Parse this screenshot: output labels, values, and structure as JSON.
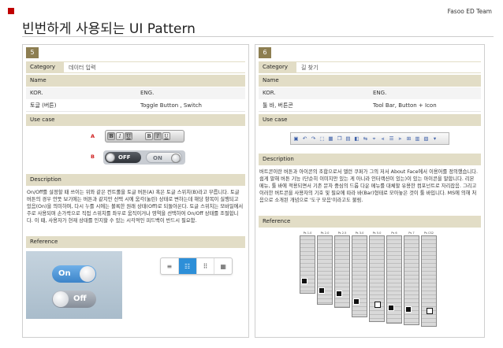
{
  "header": {
    "team": "Fasoo ED Team",
    "title": "빈번하게 사용되는 UI Pattern"
  },
  "colors": {
    "brand": "#c00000",
    "bar": "#e2ddc6",
    "number": "#8d7e51",
    "accent": "#2d8fd8"
  },
  "panels": [
    {
      "number": "5",
      "category_label": "Category",
      "category_value": "데이터 입력",
      "name_label": "Name",
      "kor_label": "KOR.",
      "eng_label": "ENG.",
      "kor_value": "토글 (버튼)",
      "eng_value": "Toggle Button , Switch",
      "usecase_label": "Use case",
      "usecase_a": "A",
      "usecase_b": "B",
      "format_buttons": [
        "B",
        "I",
        "U",
        "B",
        "I",
        "U"
      ],
      "toggle_off": "OFF",
      "toggle_on": "ON",
      "description_label": "Description",
      "description": "On/Off를 설정할 때 쓰이는 위와 같은 컨트롤을 토글 버튼(A) 혹은 토글 스위치(B)라고 부릅니다. 토글 버튼의 경우 언뜻 보기에는 버튼과 같지만 선택 시에 움각(눌린) 상태로 변하는데 해당 항목이 실행되고 있음(On)을 의미하며, 다시 누를 시에는 볼록한 원래 상태(Off)로 되돌아온다. 토글 스위치는 모바일에서 주로 사용되며 손가락으로 직접 스위치를 좌우로 움직이거나 영역을 선택하여 On/Off 상태를 조절합니다. 이 때, 사용자가 현재 상태를 인지할 수 있는 시각적인 피드백이 반드시 필요함.",
      "reference_label": "Reference",
      "ref_on": "On",
      "ref_off": "Off",
      "segment_icons": [
        "≡",
        "☷",
        "⠿",
        "▦"
      ]
    },
    {
      "number": "6",
      "category_label": "Category",
      "category_value": "길 찾기",
      "name_label": "Name",
      "kor_label": "KOR.",
      "eng_label": "ENG.",
      "kor_value": "툴 바, 버튼콘",
      "eng_value": "Tool Bar, Button + Icon",
      "usecase_label": "Use case",
      "description_label": "Description",
      "description": "버트콘이란 버튼과 아이콘의 조합으로서 앨런 쿠퍼가 그의 저서 About Face에서 이용어를 정의했습니다. 쉽게 말해 버튼 기능 (단순히 이미지만 있는 게 아니라 인터랙션이 있는)이 있는 아이콘을 말합니다. 리본 메뉴, 툴 바에 적용되면서 기존 문자 중심의 드롭 다운 메뉴를 대체할 유용한 컴포넌트로 자리잡음. 그리고 이러한 버트콘을 사용자의 기호 및 필요에 따라 바(Bar)형태로 모아놓은 것이 툴 바입니다. MS에 의해 처음으로 소개된 개념으로 '도구 모음'이라고도 불림.",
      "reference_label": "Reference",
      "palette_versions": [
        "Ps 1.0",
        "Ps 2.0",
        "Ps 2.5",
        "Ps 3.0",
        "Ps 5.0",
        "Ps 6",
        "Ps 7",
        "Ps CS2"
      ]
    }
  ]
}
